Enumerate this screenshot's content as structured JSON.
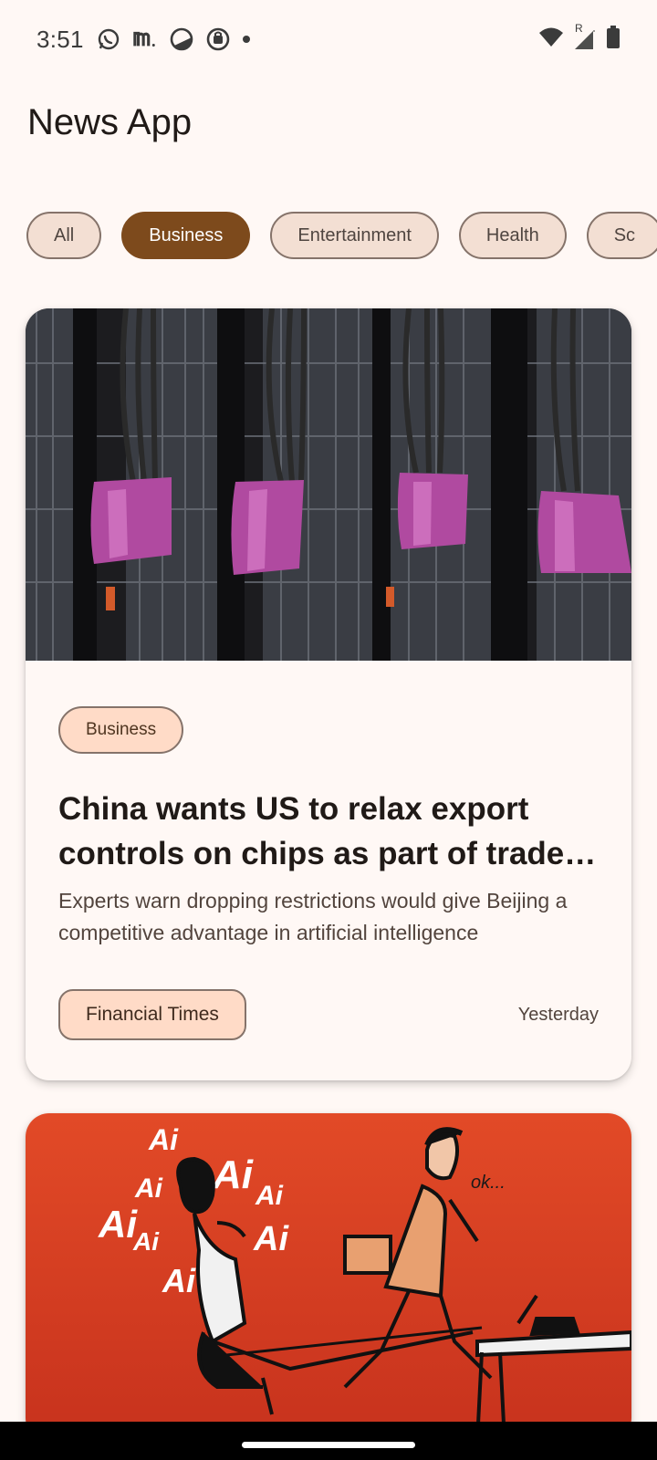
{
  "status_bar": {
    "time": "3:51",
    "icons_left": [
      "whatsapp-icon",
      "medium-icon",
      "contrast-icon",
      "app-icon",
      "notification-dot"
    ],
    "icons_right": [
      "wifi-icon",
      "signal-roaming-icon",
      "battery-icon"
    ],
    "roaming_label": "R"
  },
  "header": {
    "title": "News App"
  },
  "categories": {
    "items": [
      "All",
      "Business",
      "Entertainment",
      "Health",
      "Sc"
    ],
    "selected": "Business"
  },
  "articles": [
    {
      "category": "Business",
      "headline": "China wants US to relax export controls on chips as part of trade…",
      "description": "Experts warn dropping restrictions would give Beijing a competitive advantage in artificial intelligence",
      "source": "Financial Times",
      "time": "Yesterday",
      "image": "server-racks-photo"
    },
    {
      "image": "ai-illustration",
      "illustration_text": {
        "ai": "Ai",
        "ok": "ok..."
      }
    }
  ],
  "colors": {
    "background": "#fff8f5",
    "selected_chip": "#7d4a1c",
    "chip_bg": "#f3dfd3",
    "tag_bg": "#ffdbc7",
    "illustration_bg": "#e24a27"
  }
}
